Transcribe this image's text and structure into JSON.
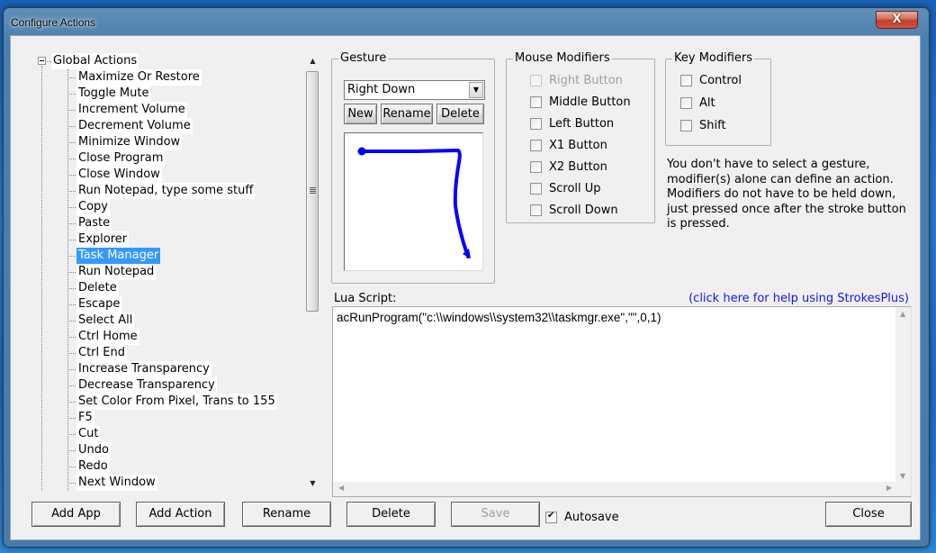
{
  "window": {
    "title": "Configure Actions",
    "close_label": "X"
  },
  "tree": {
    "root_label": "Global Actions",
    "expander_state": "expanded",
    "items": [
      {
        "label": "Maximize Or Restore"
      },
      {
        "label": "Toggle Mute"
      },
      {
        "label": "Increment Volume"
      },
      {
        "label": "Decrement Volume"
      },
      {
        "label": "Minimize Window"
      },
      {
        "label": "Close Program"
      },
      {
        "label": "Close Window"
      },
      {
        "label": "Run Notepad, type some stuff"
      },
      {
        "label": "Copy"
      },
      {
        "label": "Paste"
      },
      {
        "label": "Explorer"
      },
      {
        "label": "Task Manager",
        "selected": true
      },
      {
        "label": "Run Notepad"
      },
      {
        "label": "Delete"
      },
      {
        "label": "Escape"
      },
      {
        "label": "Select All"
      },
      {
        "label": "Ctrl Home"
      },
      {
        "label": "Ctrl End"
      },
      {
        "label": "Increase Transparency"
      },
      {
        "label": "Decrease Transparency"
      },
      {
        "label": "Set Color From Pixel, Trans to 155"
      },
      {
        "label": "F5"
      },
      {
        "label": "Cut"
      },
      {
        "label": "Undo"
      },
      {
        "label": "Redo"
      },
      {
        "label": "Next Window"
      }
    ]
  },
  "gesture": {
    "group_title": "Gesture",
    "selected": "Right Down",
    "new_label": "New",
    "rename_label": "Rename",
    "delete_label": "Delete",
    "stroke_color": "#0000ff"
  },
  "mouse_modifiers": {
    "group_title": "Mouse Modifiers",
    "items": [
      {
        "label": "Right Button",
        "checked": false,
        "disabled": true
      },
      {
        "label": "Middle Button",
        "checked": false
      },
      {
        "label": "Left Button",
        "checked": false
      },
      {
        "label": "X1 Button",
        "checked": false
      },
      {
        "label": "X2 Button",
        "checked": false
      },
      {
        "label": "Scroll Up",
        "checked": false
      },
      {
        "label": "Scroll Down",
        "checked": false
      }
    ]
  },
  "key_modifiers": {
    "group_title": "Key Modifiers",
    "items": [
      {
        "label": "Control",
        "checked": false
      },
      {
        "label": "Alt",
        "checked": false
      },
      {
        "label": "Shift",
        "checked": false
      }
    ]
  },
  "note": "You don't have to select a gesture, modifier(s) alone can define an action. Modifiers do not have to be held down, just pressed once after the stroke button is pressed.",
  "lua": {
    "label": "Lua Script:",
    "help_link": "(click here for help using StrokesPlus)",
    "code": "acRunProgram(\"c:\\\\windows\\\\system32\\\\taskmgr.exe\",\"\",0,1)"
  },
  "footer": {
    "add_app": "Add App",
    "add_action": "Add Action",
    "rename": "Rename",
    "delete": "Delete",
    "save": "Save",
    "autosave_label": "Autosave",
    "autosave_checked": true,
    "close": "Close"
  }
}
